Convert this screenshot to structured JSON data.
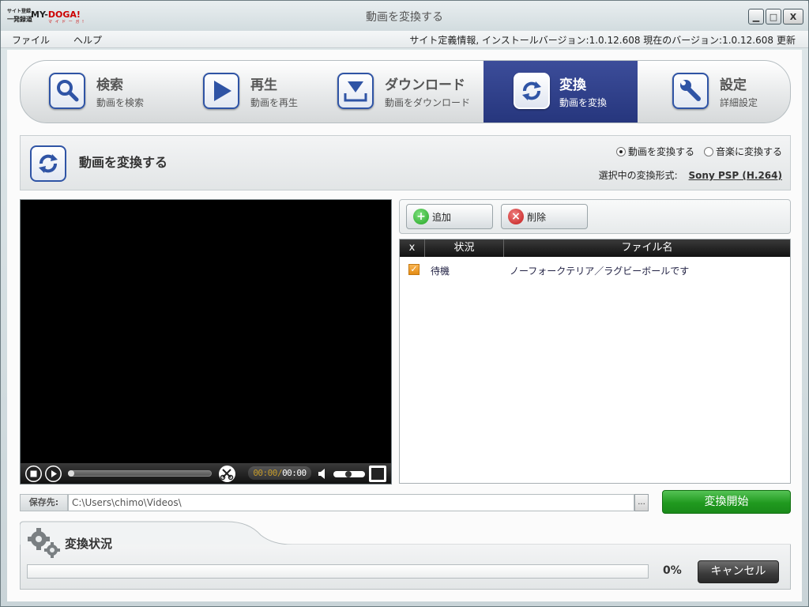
{
  "window": {
    "title": "動画を変換する",
    "logo": {
      "line1": "サイト登録",
      "line2": "一発録道",
      "brand_prefix": "MY-",
      "brand_main": "DOGA!",
      "brand_kana": "マ イ ド ー ガ !"
    },
    "controls": {
      "minimize": "▁",
      "maximize": "□",
      "close": "X"
    }
  },
  "menubar": {
    "items": [
      "ファイル",
      "ヘルプ"
    ],
    "version_info": "サイト定義情報, インストールバージョン:1.0.12.608 現在のバージョン:1.0.12.608",
    "update_label": "更新"
  },
  "nav": {
    "items": [
      {
        "label": "検索",
        "sub": "動画を検索",
        "icon": "search-icon",
        "active": false
      },
      {
        "label": "再生",
        "sub": "動画を再生",
        "icon": "play-icon",
        "active": false
      },
      {
        "label": "ダウンロード",
        "sub": "動画をダウンロード",
        "icon": "download-icon",
        "active": false
      },
      {
        "label": "変換",
        "sub": "動画を変換",
        "icon": "convert-icon",
        "active": true
      },
      {
        "label": "設定",
        "sub": "詳細設定",
        "icon": "wrench-icon",
        "active": false
      }
    ]
  },
  "section": {
    "title": "動画を変換する",
    "radio_video": "動画を変換する",
    "radio_audio": "音楽に変換する",
    "selected_radio": "video",
    "format_label": "選択中の変換形式:",
    "format_value": "Sony PSP (H.264)"
  },
  "player": {
    "time_current": "00:00",
    "time_separator": "/",
    "time_total": "00:00"
  },
  "files": {
    "add_label": "追加",
    "delete_label": "削除",
    "columns": [
      "x",
      "状況",
      "ファイル名"
    ],
    "rows": [
      {
        "checked": true,
        "status": "待機",
        "filename": "ノーフォークテリア／ラグビーボールです"
      }
    ]
  },
  "save": {
    "label": "保存先:",
    "path": "C:\\Users\\chimo\\Videos\\",
    "browse_label": "...",
    "start_label": "変換開始"
  },
  "progress": {
    "title": "変換状況",
    "percent": "0%",
    "value": 0,
    "cancel_label": "キャンセル"
  },
  "colors": {
    "nav_active": "#2e3f8c",
    "start_button": "#229c21",
    "checkbox": "#ef9c2c",
    "accent_blue": "#2f54a5"
  }
}
